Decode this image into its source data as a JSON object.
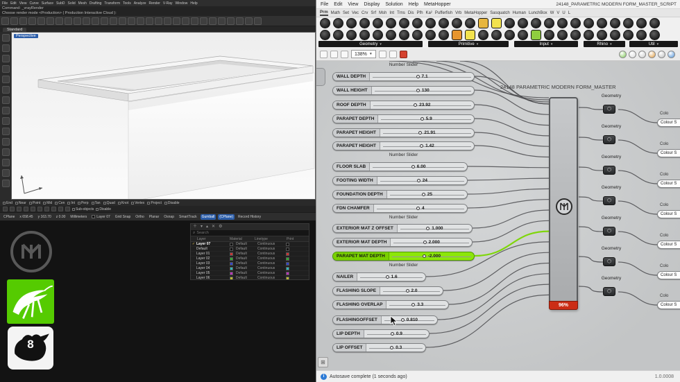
{
  "rhino": {
    "menu_items": [
      "File",
      "Edit",
      "View",
      "Curve",
      "Surface",
      "SubD",
      "Solid",
      "Mesh",
      "Drafting",
      "Transform",
      "Tools",
      "Analyze",
      "Render",
      "V-Ray",
      "Window",
      "Help"
    ],
    "command_line1": "Command: _vrayRender",
    "command_line2": "Choose render mode <Production> ( Production  Interactive  Cloud ):",
    "toolbar_tab": "Standard",
    "viewport": {
      "label": "Perspective"
    },
    "osnap_items": [
      "End",
      "Near",
      "Point",
      "Mid",
      "Cen",
      "Int",
      "Perp",
      "Tan",
      "Quad",
      "Knot",
      "Vertex",
      "Project",
      "Disable"
    ],
    "filter_items": [
      "Sub-objects",
      "Disable"
    ],
    "status": {
      "items": [
        {
          "label": "CPlane"
        },
        {
          "label": "x 658.45"
        },
        {
          "label": "y 163.70"
        },
        {
          "label": "z 0.00"
        },
        {
          "label": "Millimeters"
        },
        {
          "label": "Layer 07",
          "chip": "#111111"
        },
        {
          "label": "Grid Snap"
        },
        {
          "label": "Ortho"
        },
        {
          "label": "Planar"
        },
        {
          "label": "Osnap"
        },
        {
          "label": "SmartTrack"
        },
        {
          "label": "Gumball"
        },
        {
          "label": "(CPlane)"
        },
        {
          "label": "Record History"
        }
      ],
      "highlighted": [
        "Gumball",
        "(CPlane)"
      ]
    },
    "layers_panel": {
      "search_placeholder": "Search",
      "columns": [
        "Layer",
        "Material",
        "Linetype",
        "Print"
      ],
      "rows": [
        {
          "name": "Layer 07",
          "current": true,
          "color": "#111111",
          "material": "Default",
          "linetype": "Continuous"
        },
        {
          "name": "Default",
          "current": false,
          "color": "#111111",
          "material": "Default",
          "linetype": "Continuous"
        },
        {
          "name": "Layer 01",
          "current": false,
          "color": "#cc3333",
          "material": "Default",
          "linetype": "Continuous"
        },
        {
          "name": "Layer 02",
          "current": false,
          "color": "#33aa33",
          "material": "Default",
          "linetype": "Continuous"
        },
        {
          "name": "Layer 03",
          "current": false,
          "color": "#3344cc",
          "material": "Default",
          "linetype": "Continuous"
        },
        {
          "name": "Layer 04",
          "current": false,
          "color": "#33bbbb",
          "material": "Default",
          "linetype": "Continuous"
        },
        {
          "name": "Layer 05",
          "current": false,
          "color": "#bb33bb",
          "material": "Default",
          "linetype": "Continuous"
        },
        {
          "name": "Layer 06",
          "current": false,
          "color": "#bbbb33",
          "material": "Default",
          "linetype": "Continuous"
        }
      ]
    },
    "dock": {
      "rhino8_label": "8"
    }
  },
  "grasshopper": {
    "menu_items": [
      "File",
      "Edit",
      "View",
      "Display",
      "Solution",
      "Help",
      "MetaHopper"
    ],
    "window_title": "24148_PARAMETRIC MODERN FORM_MASTER_SCRIPT",
    "tabs": [
      "Prm",
      "Math",
      "Set",
      "Vec",
      "Crv",
      "Srf",
      "Msh",
      "Int",
      "Trns",
      "Dis",
      "Pfh",
      "Ka²",
      "Pufferfish",
      "Vrb",
      "MetaHopper",
      "Sasquatch",
      "Human",
      "LunchBox",
      "W",
      "V",
      "U",
      "L"
    ],
    "active_tab": "Prm",
    "category_labels": [
      "Geometry",
      "Primitive",
      "Input",
      "Rhino",
      "Util"
    ],
    "zoom_level": "138%",
    "canvas": {
      "items": [
        {
          "type": "header",
          "label": "Number Slider"
        },
        {
          "type": "slider",
          "name": "WALL DEPTH",
          "value": "7.1"
        },
        {
          "type": "slider",
          "name": "WALL HEIGHT",
          "value": "130"
        },
        {
          "type": "slider",
          "name": "ROOF DEPTH",
          "value": "23.92"
        },
        {
          "type": "slider",
          "name": "PARAPET DEPTH",
          "value": "5.9"
        },
        {
          "type": "slider",
          "name": "PARAPET HEIGHT",
          "value": "21.91"
        },
        {
          "type": "slider",
          "name": "PARAPET HEIGHT",
          "value": "1.42"
        },
        {
          "type": "header",
          "label": "Number Slider"
        },
        {
          "type": "slider",
          "name": "FLOOR SLAB",
          "value": "6.00"
        },
        {
          "type": "slider",
          "name": "FOOTING WIDTH",
          "value": "24"
        },
        {
          "type": "slider",
          "name": "FOUNDATION DEPTH",
          "value": "25"
        },
        {
          "type": "slider",
          "name": "FDN CHAMFER",
          "value": "4"
        },
        {
          "type": "header",
          "label": "Number Slider"
        },
        {
          "type": "slider",
          "name": "EXTERIOR MAT Z OFFSET",
          "value": "1.000"
        },
        {
          "type": "slider",
          "name": "EXTERIOR MAT DEPTH",
          "value": "2.000"
        },
        {
          "type": "slider",
          "name": "PARAPET MAT DEPTH",
          "value": "-2.000",
          "highlight": true
        },
        {
          "type": "header",
          "label": "Number Slider"
        },
        {
          "type": "slider",
          "name": "NAILER",
          "value": "1.6"
        },
        {
          "type": "slider",
          "name": "FLASHING SLOPE",
          "value": "2.0"
        },
        {
          "type": "slider",
          "name": "FLASHING OVERLAP",
          "value": "3.3"
        },
        {
          "type": "slider",
          "name": "FLASHINGOFFSET",
          "value": "0.810"
        },
        {
          "type": "slider",
          "name": "LIP DEPTH",
          "value": "0.9"
        },
        {
          "type": "slider",
          "name": "LIP OFFSET",
          "value": "0.3"
        }
      ],
      "cluster": {
        "title": "24148 PARAMETRIC MODERN FORM_MASTER",
        "progress": "96%"
      },
      "outputs": [
        {
          "label": "Geometry"
        },
        {
          "label": "Geometry"
        },
        {
          "label": "Geometry"
        },
        {
          "label": "Geometry"
        },
        {
          "label": "Geometry"
        },
        {
          "label": "Geometry"
        },
        {
          "label": "Geometry"
        }
      ],
      "swatches": [
        {
          "top_label": "Colo",
          "label": "Colour S"
        },
        {
          "top_label": "Colo",
          "label": "Colour S"
        },
        {
          "top_label": "Colo",
          "label": "Colour S"
        },
        {
          "top_label": "Colo",
          "label": "Colour S"
        },
        {
          "top_label": "Colo",
          "label": "Colour S"
        },
        {
          "top_label": "Colo",
          "label": "Colour S"
        },
        {
          "top_label": "Colo",
          "label": "Colour S"
        }
      ]
    },
    "statusbar": {
      "autosave": "Autosave complete (1 seconds ago)",
      "version": "1.0.0008"
    }
  },
  "colors": {
    "accent_green": "#7fd60a",
    "progress_red": "#cb2d15",
    "highlight_blue": "#2a5ca8"
  }
}
